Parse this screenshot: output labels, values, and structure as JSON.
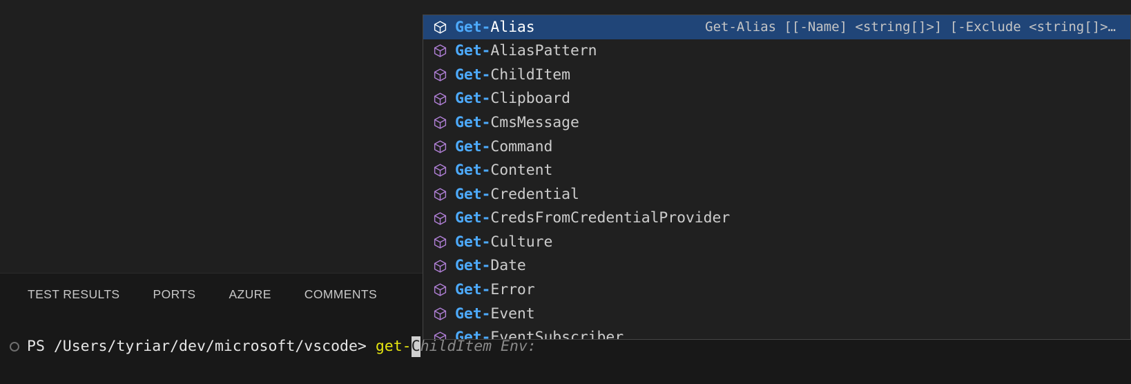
{
  "colors": {
    "editor_background": "#1f1f1f",
    "panel_background": "#181818",
    "widget_background": "#202020",
    "widget_border": "#454545",
    "selection_background": "#204578",
    "match_highlight": "#4daafc",
    "icon_purple": "#b180d7",
    "foreground": "#cccccc",
    "prompt_typed_yellow": "#e5e510",
    "ghost_text": "#8a8a8a"
  },
  "panel": {
    "tabs": [
      {
        "label": "TEST RESULTS",
        "active": false
      },
      {
        "label": "PORTS",
        "active": false
      },
      {
        "label": "AZURE",
        "active": false
      },
      {
        "label": "COMMENTS",
        "active": false
      }
    ]
  },
  "terminal": {
    "decoration_icon": "command-status-circle-icon",
    "prompt": "PS /Users/tyriar/dev/microsoft/vscode> ",
    "typed": "get-",
    "cursor_char": "C",
    "ghost_text": "hildItem Env:"
  },
  "suggest_widget": {
    "icon_name": "symbol-method-cube-icon",
    "items": [
      {
        "match": "Get-",
        "rest": "Alias",
        "selected": true,
        "detail": "Get-Alias [[-Name] <string[]>] [-Exclude <string[]>…"
      },
      {
        "match": "Get-",
        "rest": "AliasPattern",
        "selected": false,
        "detail": ""
      },
      {
        "match": "Get-",
        "rest": "ChildItem",
        "selected": false,
        "detail": ""
      },
      {
        "match": "Get-",
        "rest": "Clipboard",
        "selected": false,
        "detail": ""
      },
      {
        "match": "Get-",
        "rest": "CmsMessage",
        "selected": false,
        "detail": ""
      },
      {
        "match": "Get-",
        "rest": "Command",
        "selected": false,
        "detail": ""
      },
      {
        "match": "Get-",
        "rest": "Content",
        "selected": false,
        "detail": ""
      },
      {
        "match": "Get-",
        "rest": "Credential",
        "selected": false,
        "detail": ""
      },
      {
        "match": "Get-",
        "rest": "CredsFromCredentialProvider",
        "selected": false,
        "detail": ""
      },
      {
        "match": "Get-",
        "rest": "Culture",
        "selected": false,
        "detail": ""
      },
      {
        "match": "Get-",
        "rest": "Date",
        "selected": false,
        "detail": ""
      },
      {
        "match": "Get-",
        "rest": "Error",
        "selected": false,
        "detail": ""
      },
      {
        "match": "Get-",
        "rest": "Event",
        "selected": false,
        "detail": ""
      },
      {
        "match": "Get-",
        "rest": "EventSubscriber",
        "selected": false,
        "detail": ""
      }
    ]
  }
}
